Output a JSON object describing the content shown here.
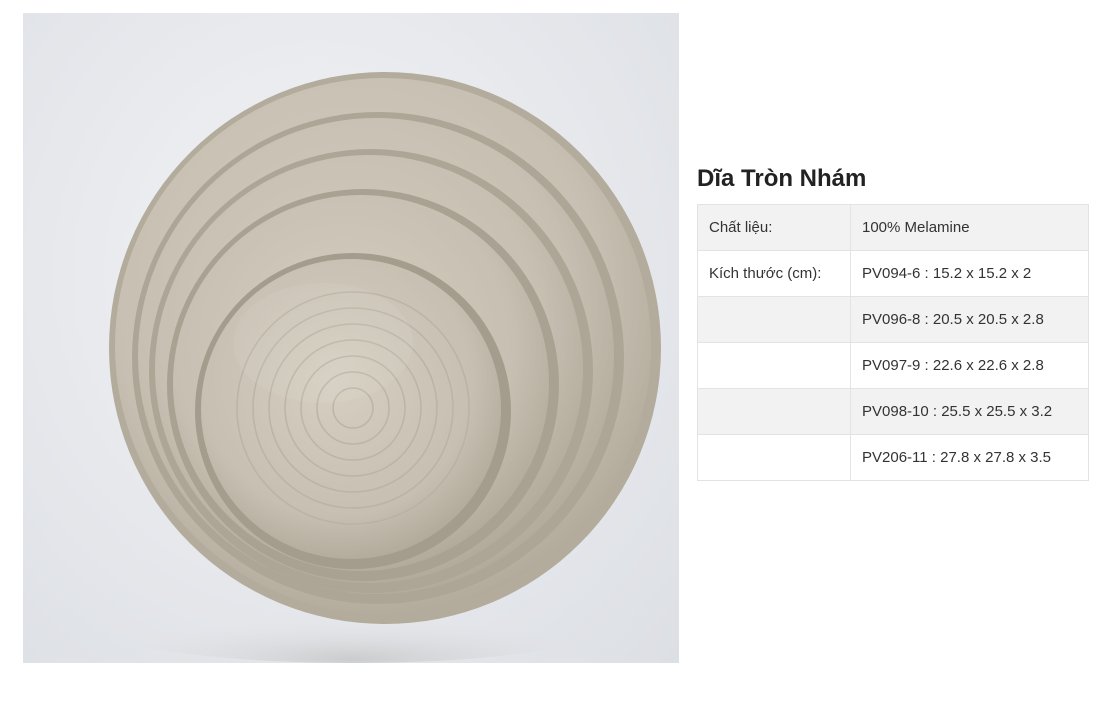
{
  "product": {
    "title": "Dĩa Tròn Nhám",
    "image_subject": "stack of five round speckled beige plates"
  },
  "specs": [
    {
      "label": "Chất liệu:",
      "value": "100% Melamine"
    },
    {
      "label": "Kích thước (cm):",
      "value": "PV094-6 : 15.2 x 15.2 x 2"
    },
    {
      "label": "",
      "value": "PV096-8 : 20.5 x 20.5 x 2.8"
    },
    {
      "label": "",
      "value": "PV097-9 : 22.6 x 22.6 x 2.8"
    },
    {
      "label": "",
      "value": "PV098-10 : 25.5 x 25.5 x 3.2"
    },
    {
      "label": "",
      "value": "PV206-11 : 27.8 x 27.8 x 3.5"
    }
  ],
  "colors": {
    "plate": "#c9c1b3",
    "plate_shadow": "#a89f90",
    "background": "#e6e8ec"
  }
}
